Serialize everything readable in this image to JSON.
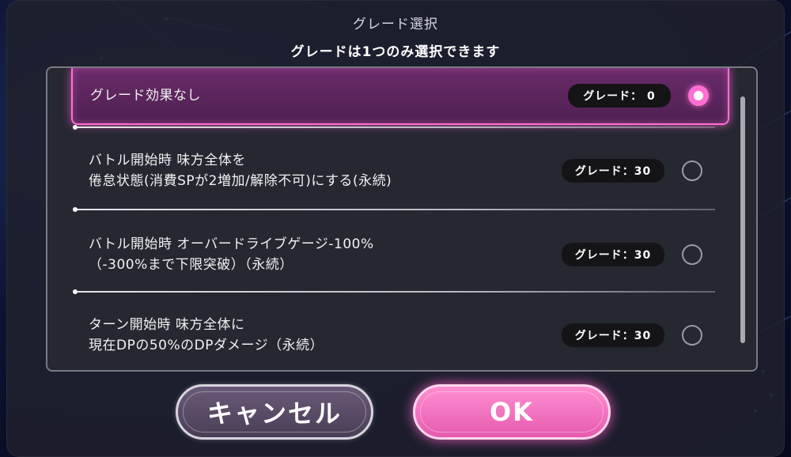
{
  "dialog": {
    "title": "グレード選択",
    "subtitle": "グレードは1つのみ選択できます"
  },
  "options": [
    {
      "label": "グレード効果なし",
      "grade": "グレード： 0",
      "selected": true
    },
    {
      "label": "バトル開始時 味方全体を\n倦怠状態(消費SPが2増加/解除不可)にする(永続)",
      "grade": "グレード：30",
      "selected": false
    },
    {
      "label": "バトル開始時 オーバードライブゲージ-100%\n（-300%まで下限突破）（永続）",
      "grade": "グレード：30",
      "selected": false
    },
    {
      "label": "ターン開始時 味方全体に\n現在DPの50%のDPダメージ（永続）",
      "grade": "グレード：30",
      "selected": false
    }
  ],
  "buttons": {
    "cancel": "キャンセル",
    "ok": "OK"
  },
  "colors": {
    "accent": "#ff6fd2",
    "selected_row": "#5a2558",
    "panel": "#26282f"
  }
}
